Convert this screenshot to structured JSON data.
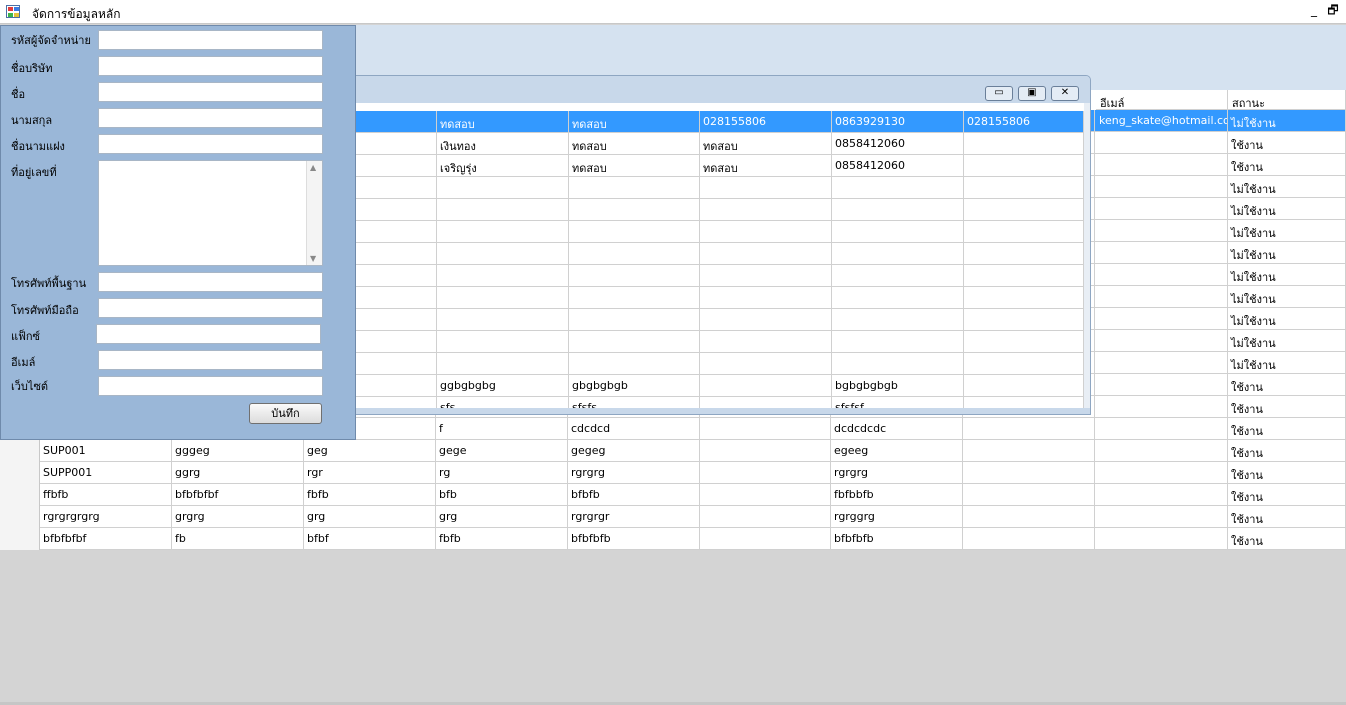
{
  "window": {
    "title": "จัดการข้อมูลหลัก",
    "min_glyph": "_",
    "restore_glyph": "🗗"
  },
  "form": {
    "labels": {
      "supplier_code": "รหัสผู้จัดจำหน่าย",
      "company_name": "ชื่อบริษัท",
      "first_name": "ชื่อ",
      "last_name": "นามสกุล",
      "alias": "ชื่อนามแฝง",
      "address": "ที่อยู่เลขที่",
      "phone": "โทรศัพท์พื้นฐาน",
      "mobile": "โทรศัพท์มือถือ",
      "fax": "แฟ็กซ์",
      "email": "อีเมล์",
      "website": "เว็บไซต์"
    },
    "values": {
      "supplier_code": "",
      "company_name": "",
      "first_name": "",
      "last_name": "",
      "alias": "",
      "address": "",
      "phone": "",
      "mobile": "",
      "fax": "",
      "email": "",
      "website": ""
    },
    "save_label": "บันทึก"
  },
  "main_grid": {
    "headers": [
      "อีเมล์",
      "สถานะ"
    ],
    "rows": [
      [
        "",
        "",
        "",
        "",
        "",
        "",
        "",
        "",
        "keng_skate@hotmail.com",
        "ไม่ใช้งาน"
      ],
      [
        "",
        "",
        "",
        "",
        "",
        "",
        "",
        "",
        "",
        "ใช้งาน"
      ],
      [
        "",
        "",
        "",
        "",
        "",
        "",
        "",
        "",
        "",
        "ใช้งาน"
      ],
      [
        "",
        "",
        "",
        "",
        "",
        "",
        "",
        "",
        "",
        "ไม่ใช้งาน"
      ],
      [
        "",
        "",
        "",
        "",
        "",
        "",
        "",
        "",
        "",
        "ไม่ใช้งาน"
      ],
      [
        "",
        "",
        "",
        "",
        "",
        "",
        "",
        "",
        "",
        "ไม่ใช้งาน"
      ],
      [
        "",
        "",
        "",
        "",
        "",
        "",
        "",
        "",
        "",
        "ไม่ใช้งาน"
      ],
      [
        "",
        "",
        "",
        "",
        "",
        "",
        "",
        "",
        "",
        "ไม่ใช้งาน"
      ],
      [
        "",
        "",
        "",
        "",
        "",
        "",
        "",
        "",
        "",
        "ไม่ใช้งาน"
      ],
      [
        "",
        "",
        "",
        "",
        "",
        "",
        "",
        "",
        "",
        "ไม่ใช้งาน"
      ],
      [
        "",
        "",
        "",
        "",
        "",
        "",
        "",
        "",
        "",
        "ไม่ใช้งาน"
      ],
      [
        "",
        "",
        "",
        "",
        "",
        "",
        "",
        "",
        "",
        "ไม่ใช้งาน"
      ],
      [
        "",
        "",
        "",
        "",
        "",
        "",
        "",
        "",
        "",
        "ใช้งาน"
      ],
      [
        "",
        "",
        "",
        "",
        "",
        "",
        "",
        "",
        "",
        "ใช้งาน"
      ],
      [
        "",
        "",
        "",
        "f",
        "cdcdcd",
        "",
        "dcdcdcdc",
        "",
        "",
        "ใช้งาน"
      ],
      [
        "SUP001",
        "gggeg",
        "geg",
        "gege",
        "gegeg",
        "",
        "egeeg",
        "",
        "",
        "ใช้งาน"
      ],
      [
        "SUPP001",
        "ggrg",
        "rgr",
        "rg",
        "rgrgrg",
        "",
        "rgrgrg",
        "",
        "",
        "ใช้งาน"
      ],
      [
        "ffbfb",
        "bfbfbfbf",
        "fbfb",
        "bfb",
        "bfbfb",
        "",
        "fbfbbfb",
        "",
        "",
        "ใช้งาน"
      ],
      [
        "rgrgrgrgrg",
        "grgrg",
        "grg",
        "grg",
        "rgrgrgr",
        "",
        "rgrggrg",
        "",
        "",
        "ใช้งาน"
      ],
      [
        "bfbfbfbf",
        "fb",
        "bfbf",
        "fbfb",
        "bfbfbfb",
        "",
        "bfbfbfb",
        "",
        "",
        "ใช้งาน"
      ]
    ]
  },
  "child_window": {
    "min_glyph": "▭",
    "max_glyph": "▣",
    "close_glyph": "✕",
    "rows": [
      [
        "",
        "ทดสอบ",
        "ทดสอบ",
        "028155806",
        "0863929130",
        "028155806"
      ],
      [
        "",
        "เงินทอง",
        "ทดสอบ",
        "ทดสอบ",
        "0858412060",
        ""
      ],
      [
        "",
        "เจริญรุ่ง",
        "ทดสอบ",
        "ทดสอบ",
        "0858412060",
        ""
      ],
      [
        "",
        "",
        "",
        "",
        "",
        ""
      ],
      [
        "",
        "",
        "",
        "",
        "",
        ""
      ],
      [
        "",
        "",
        "",
        "",
        "",
        ""
      ],
      [
        "",
        "",
        "",
        "",
        "",
        ""
      ],
      [
        "",
        "",
        "",
        "",
        "",
        ""
      ],
      [
        "",
        "",
        "",
        "",
        "",
        ""
      ],
      [
        "",
        "",
        "",
        "",
        "",
        ""
      ],
      [
        "",
        "",
        "",
        "",
        "",
        ""
      ],
      [
        "",
        "",
        "",
        "",
        "",
        ""
      ],
      [
        "",
        "ggbgbgbg",
        "gbgbgbgb",
        "",
        "bgbgbgbgb",
        ""
      ],
      [
        "",
        "sfs",
        "sfsfs",
        "",
        "sfsfsf",
        ""
      ]
    ]
  }
}
